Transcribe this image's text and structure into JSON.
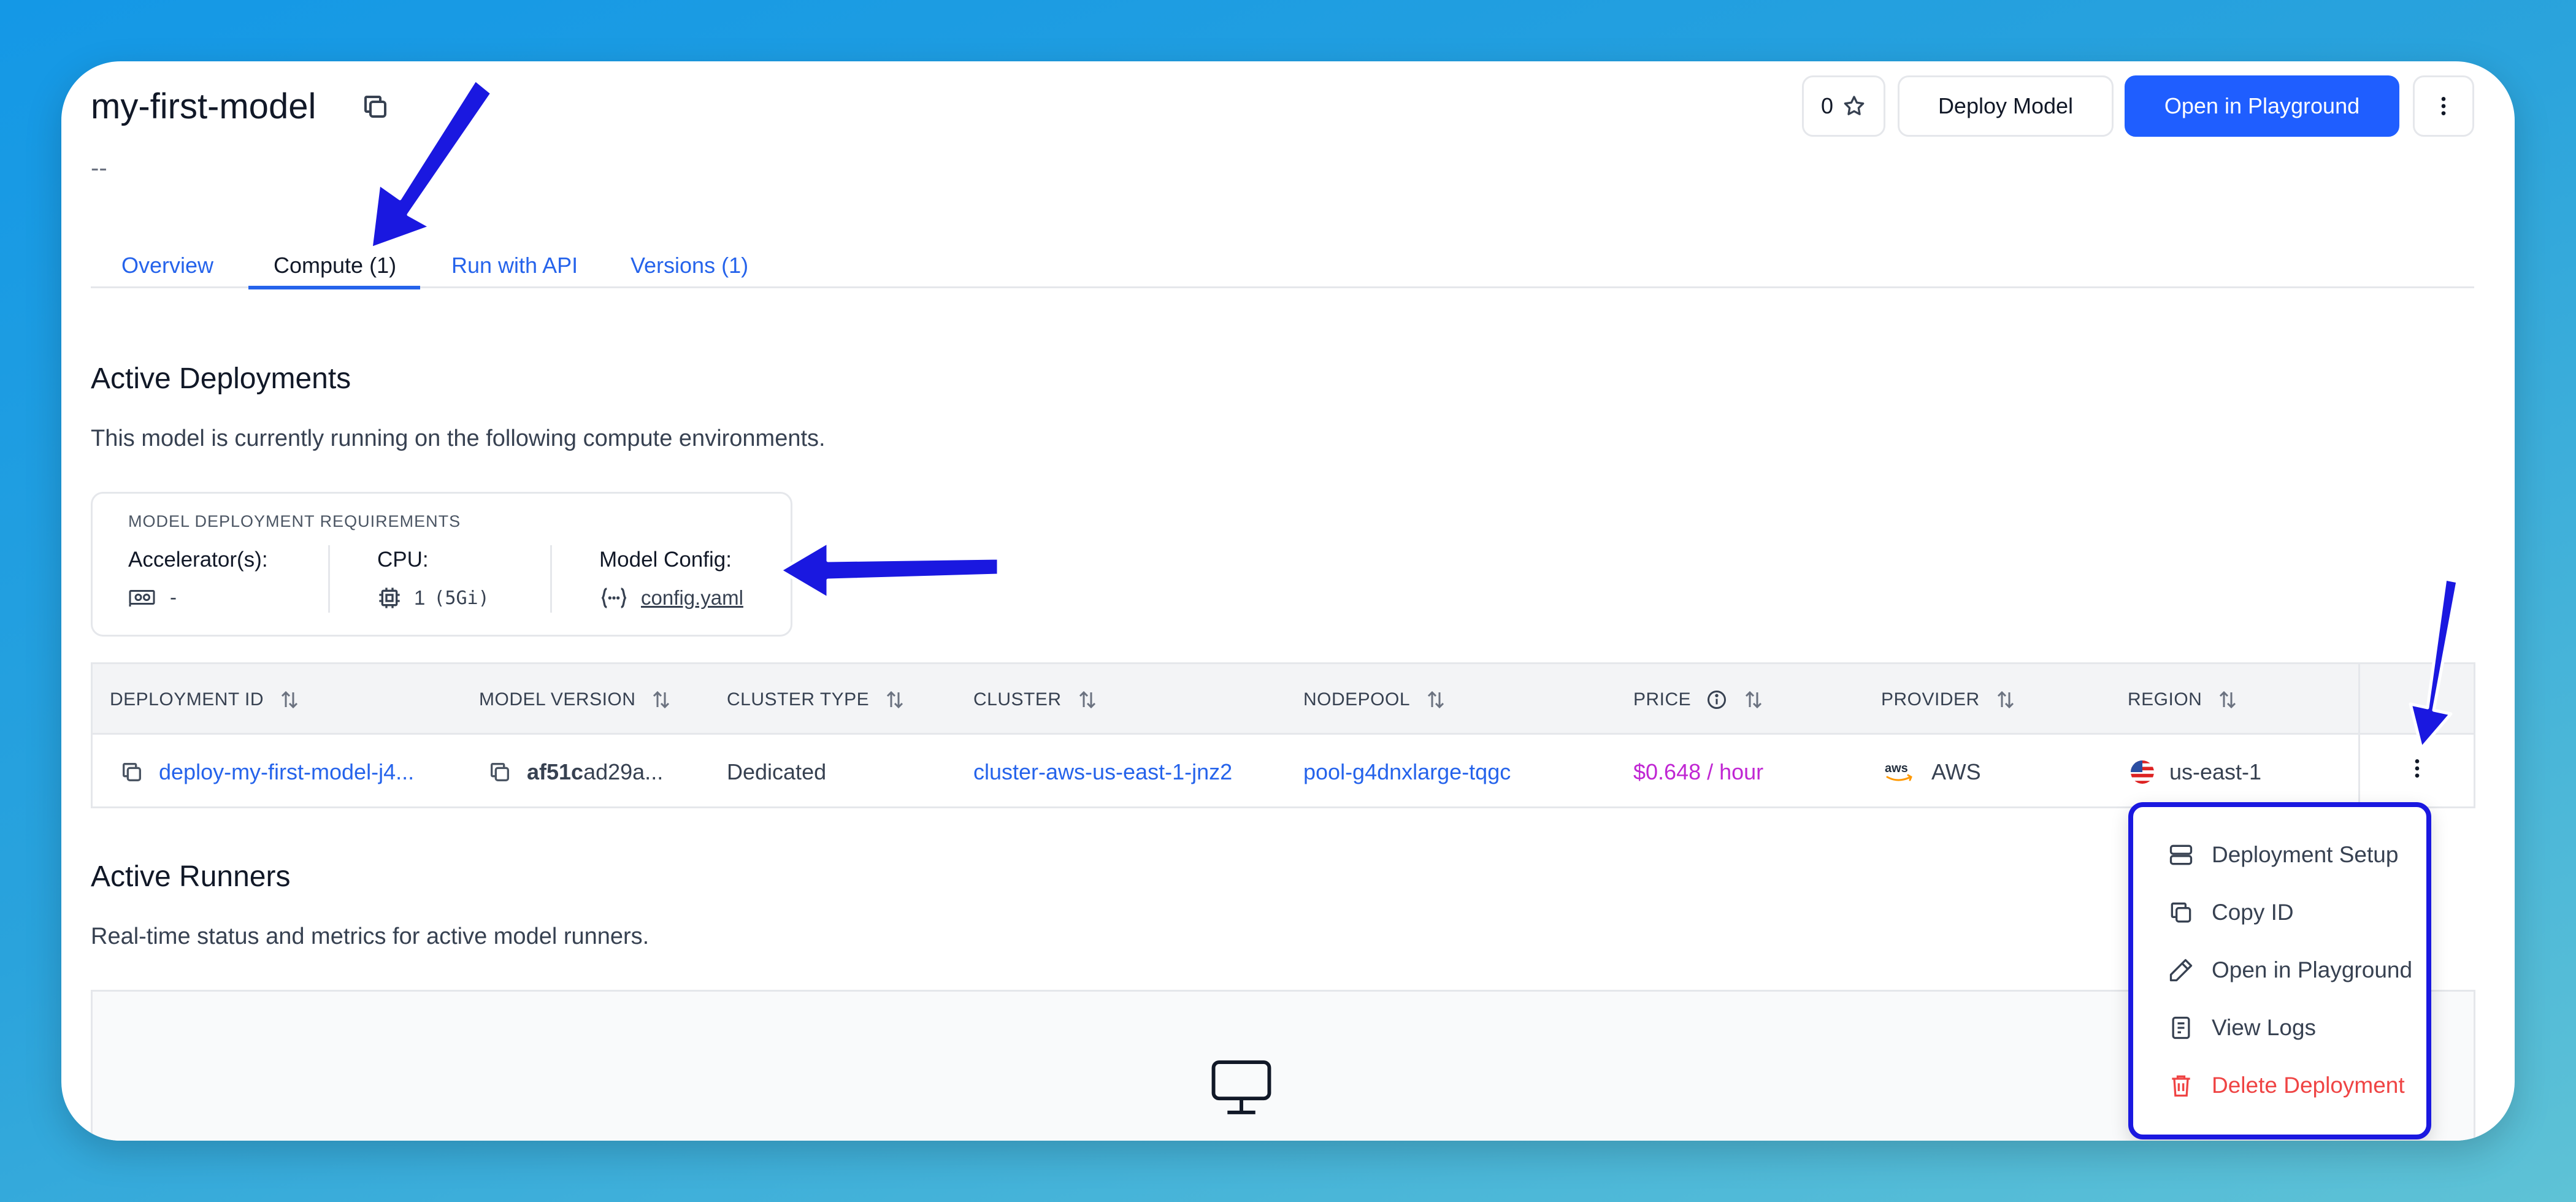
{
  "header": {
    "title": "my-first-model",
    "subtitle": "--",
    "star_count": "0",
    "deploy_label": "Deploy Model",
    "playground_label": "Open in Playground"
  },
  "tabs": [
    {
      "label": "Overview"
    },
    {
      "label": "Compute (1)",
      "active": true
    },
    {
      "label": "Run with API"
    },
    {
      "label": "Versions (1)"
    }
  ],
  "active_deployments": {
    "heading": "Active Deployments",
    "description": "This model is currently running on the following compute environments."
  },
  "requirements": {
    "heading": "MODEL DEPLOYMENT REQUIREMENTS",
    "accelerator_label": "Accelerator(s):",
    "accelerator_value": "-",
    "cpu_label": "CPU:",
    "cpu_value": "1",
    "cpu_mem": "(5Gi)",
    "config_label": "Model Config:",
    "config_value": "config.yaml"
  },
  "table": {
    "columns": [
      "DEPLOYMENT ID",
      "MODEL VERSION",
      "CLUSTER TYPE",
      "CLUSTER",
      "NODEPOOL",
      "PRICE",
      "PROVIDER",
      "REGION"
    ],
    "row": {
      "deployment_id": "deploy-my-first-model-j4...",
      "model_version_bold": "af51c",
      "model_version_rest": "ad29a...",
      "cluster_type": "Dedicated",
      "cluster": "cluster-aws-us-east-1-jnz2",
      "nodepool": "pool-g4dnxlarge-tqgc",
      "price": "$0.648 / hour",
      "provider": "AWS",
      "provider_logo": "aws",
      "region": "us-east-1"
    }
  },
  "active_runners": {
    "heading": "Active Runners",
    "description": "Real-time status and metrics for active model runners."
  },
  "menu": {
    "items": [
      {
        "label": "Deployment Setup",
        "icon": "server-icon"
      },
      {
        "label": "Copy ID",
        "icon": "copy-icon"
      },
      {
        "label": "Open in Playground",
        "icon": "pencil-icon"
      },
      {
        "label": "View Logs",
        "icon": "document-icon"
      },
      {
        "label": "Delete Deployment",
        "icon": "trash-icon",
        "danger": true
      }
    ]
  },
  "colors": {
    "primary": "#1f5eff",
    "link": "#2563eb",
    "price": "#c026d3",
    "danger": "#ef4444",
    "annotation": "#1a18e0"
  }
}
